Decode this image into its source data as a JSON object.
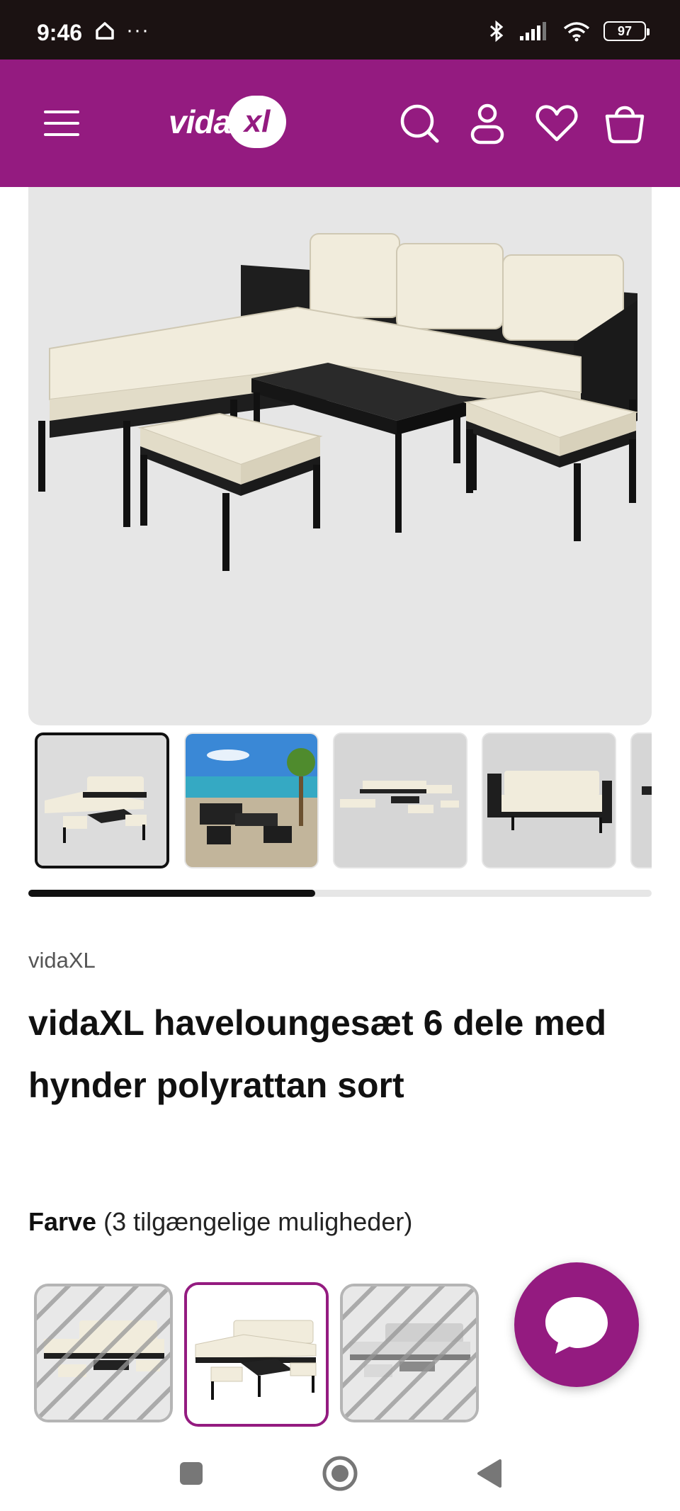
{
  "status_bar": {
    "time": "9:46",
    "dots": "···",
    "battery": "97"
  },
  "header": {
    "logo_text": "vida",
    "logo_mark": "xl",
    "brand_color": "#941b80",
    "icons": [
      "menu-icon",
      "search-icon",
      "account-icon",
      "wishlist-heart-icon",
      "basket-icon"
    ]
  },
  "gallery": {
    "thumbnail_count_visible": 5,
    "active_index": 0,
    "scroll_progress_fraction": 0.46
  },
  "product": {
    "brand": "vidaXL",
    "title": "vidaXL haveloungesæt 6 dele med hynder polyrattan sort"
  },
  "variants": {
    "label": "Farve",
    "count_text": "(3 tilgængelige muligheder)",
    "selected_index": 1,
    "items": [
      {
        "available": false
      },
      {
        "available": true
      },
      {
        "available": false
      }
    ]
  },
  "chat": {
    "icon": "chat-bubble-icon"
  },
  "nav": {
    "icons": [
      "recent-apps-icon",
      "home-icon",
      "back-icon"
    ]
  }
}
